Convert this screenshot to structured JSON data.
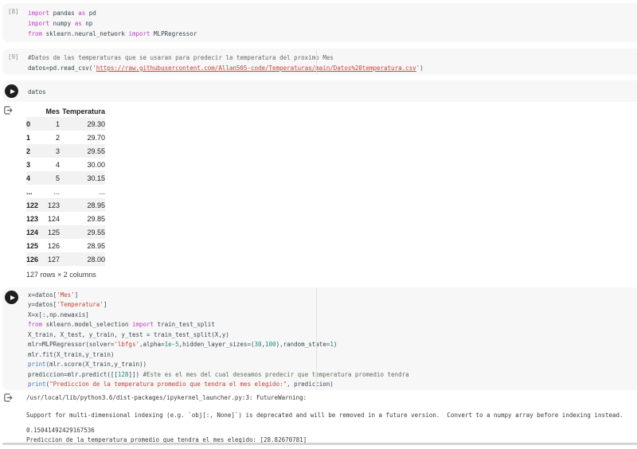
{
  "colors": {
    "keyword": "#bd3fbd",
    "string": "#c0443a",
    "number": "#1c8a7a",
    "comment": "#5f6e5f",
    "builtin": "#3e78c2",
    "text": "#37474f",
    "cell_background": "#f7f7f7",
    "stripe": "#f2f2f2",
    "run_button": "#1f1f1f"
  },
  "icons": {
    "run": "play-circle",
    "output": "output-bracket-arrow"
  },
  "cells": [
    {
      "gutter_label": "[8]",
      "code": [
        [
          [
            "k",
            "import"
          ],
          [
            "t",
            " pandas "
          ],
          [
            "k",
            "as"
          ],
          [
            "t",
            " pd"
          ]
        ],
        [
          [
            "k",
            "import"
          ],
          [
            "t",
            " numpy "
          ],
          [
            "k",
            "as"
          ],
          [
            "t",
            " np"
          ]
        ],
        [
          [
            "k",
            "from"
          ],
          [
            "t",
            " sklearn.neural_network "
          ],
          [
            "k",
            "import"
          ],
          [
            "t",
            " MLPRegressor"
          ]
        ]
      ]
    },
    {
      "gutter_label": "[9]",
      "code": [
        [
          [
            "c",
            "#Datos de las temperaturas que se usaran para predecir la temperatura del proximo Mes"
          ]
        ],
        [
          [
            "t",
            "datos=pd.read_csv("
          ],
          [
            "s",
            "'"
          ],
          [
            "l",
            "https://raw.githubusercontent.com/Allan505-code/Temperaturas/main/Datos%20temperatura.csv"
          ],
          [
            "s",
            "'"
          ],
          [
            "t",
            ")"
          ]
        ]
      ]
    },
    {
      "code": [
        [
          [
            "t",
            "datos"
          ]
        ]
      ],
      "output_table": {
        "columns": [
          "Mes",
          "Temperatura"
        ],
        "rows": [
          [
            "0",
            "1",
            "29.30"
          ],
          [
            "1",
            "2",
            "29.70"
          ],
          [
            "2",
            "3",
            "29.55"
          ],
          [
            "3",
            "4",
            "30.00"
          ],
          [
            "4",
            "5",
            "30.15"
          ],
          [
            "...",
            "...",
            "..."
          ],
          [
            "122",
            "123",
            "28.95"
          ],
          [
            "123",
            "124",
            "29.85"
          ],
          [
            "124",
            "125",
            "29.55"
          ],
          [
            "125",
            "126",
            "28.95"
          ],
          [
            "126",
            "127",
            "28.00"
          ]
        ],
        "caption": "127 rows × 2 columns"
      }
    },
    {
      "code": [
        [
          [
            "t",
            "x=datos["
          ],
          [
            "s",
            "'Mes'"
          ],
          [
            "t",
            "]"
          ]
        ],
        [
          [
            "t",
            "y=datos["
          ],
          [
            "s",
            "'Temperatura'"
          ],
          [
            "t",
            "]"
          ]
        ],
        [
          [
            "t",
            "X=x[:,np.newaxis]"
          ]
        ],
        [
          [
            "k",
            "from"
          ],
          [
            "t",
            " sklearn.model_selection "
          ],
          [
            "k",
            "import"
          ],
          [
            "t",
            " train_test_split"
          ]
        ],
        [
          [
            "t",
            "X_train, X_test, y_train, y_test = train_test_split(X,y)"
          ]
        ],
        [
          [
            "t",
            "mlr=MLPRegressor(solver="
          ],
          [
            "s",
            "'lbfgs'"
          ],
          [
            "t",
            ",alpha="
          ],
          [
            "n",
            "1e-5"
          ],
          [
            "t",
            ",hidden_layer_sizes=("
          ],
          [
            "n",
            "30"
          ],
          [
            "t",
            ","
          ],
          [
            "n",
            "100"
          ],
          [
            "t",
            "),random_state="
          ],
          [
            "n",
            "1"
          ],
          [
            "t",
            ")"
          ]
        ],
        [
          [
            "t",
            "mlr.fit(X_train,y_train)"
          ]
        ],
        [
          [
            "b",
            "print"
          ],
          [
            "t",
            "(mlr.score(X_train,y_train))"
          ]
        ],
        [
          [
            "t",
            "prediccion=mlr.predict([["
          ],
          [
            "n",
            "128"
          ],
          [
            "t",
            "]]) "
          ],
          [
            "c",
            "#Este es el mes del cual deseamos predecir que temperatura promedio tendra"
          ]
        ],
        [
          [
            "b",
            "print"
          ],
          [
            "t",
            "("
          ],
          [
            "s",
            "\"Prediccion de la temperatura promedio que tendra el mes elegido:\""
          ],
          [
            "t",
            ", prediccion)"
          ]
        ]
      ],
      "output_text": {
        "warning_lines": [
          "/usr/local/lib/python3.6/dist-packages/ipykernel_launcher.py:3: FutureWarning:",
          "",
          "Support for multi-dimensional indexing (e.g. `obj[:, None]`) is deprecated and will be removed in a future version.  Convert to a numpy array before indexing instead."
        ],
        "result_lines": [
          "0.15041492429167536",
          "Prediccion de la temperatura promedio que tendra el mes elegido: [28.82670781]"
        ]
      }
    }
  ]
}
